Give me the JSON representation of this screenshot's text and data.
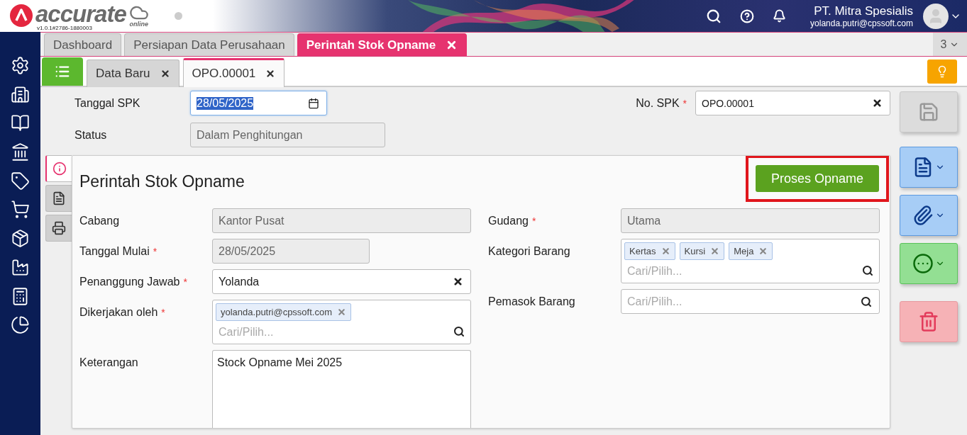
{
  "header": {
    "logo_text": "accurate",
    "logo_sub": "online",
    "version": "v1.0.1#2786-1880003",
    "company": "PT. Mitra Spesialis",
    "email": "yolanda.putri@cpssoft.com"
  },
  "tabs": [
    {
      "label": "Dashboard",
      "selected": false,
      "closable": false
    },
    {
      "label": "Persiapan Data Perusahaan",
      "selected": false,
      "closable": false
    },
    {
      "label": "Perintah Stok Opname",
      "selected": true,
      "closable": true
    }
  ],
  "tab_overflow": "3",
  "subtabs": [
    {
      "label": "Data Baru",
      "selected": false
    },
    {
      "label": "OPO.00001",
      "selected": true
    }
  ],
  "top_fields": {
    "date": {
      "label": "Tanggal SPK",
      "value": "28/05/2025",
      "text_selected": true
    },
    "number": {
      "label": "No. SPK",
      "required_mark": "*",
      "value": "OPO.00001"
    },
    "status": {
      "label": "Status",
      "value": "Dalam Penghitungan",
      "disabled": true
    }
  },
  "side_tabs": [
    {
      "kind": "info",
      "selected": true
    },
    {
      "kind": "document",
      "selected": false
    },
    {
      "kind": "print",
      "selected": false
    }
  ],
  "card": {
    "title": "Perintah Stok Opname",
    "action": {
      "label": "Proses Opname",
      "highlighted": true
    },
    "left_fields": [
      {
        "kind": "text",
        "label": "Cabang",
        "disabled": true,
        "value": "Kantor Pusat"
      },
      {
        "kind": "date",
        "label": "Tanggal Mulai",
        "required_mark": "*",
        "disabled": true,
        "value": "28/05/2025"
      },
      {
        "kind": "text",
        "label": "Penanggung Jawab",
        "required_mark": "*",
        "disabled": false,
        "clearable": true,
        "value": "Yolanda"
      },
      {
        "kind": "tags",
        "label": "Dikerjakan oleh",
        "required_mark": "*",
        "tags": [
          "yolanda.putri@cpssoft.com"
        ],
        "placeholder": "Cari/Pilih..."
      },
      {
        "kind": "textarea",
        "label": "Keterangan",
        "value": "Stock Opname Mei 2025"
      }
    ],
    "right_fields": [
      {
        "kind": "text",
        "label": "Gudang",
        "required_mark": "*",
        "disabled": true,
        "value": "Utama"
      },
      {
        "kind": "tags",
        "label": "Kategori Barang",
        "tags": [
          "Kertas",
          "Kursi",
          "Meja"
        ],
        "placeholder": "Cari/Pilih..."
      },
      {
        "kind": "lookup",
        "label": "Pemasok Barang",
        "placeholder": "Cari/Pilih..."
      }
    ]
  },
  "actions": [
    {
      "kind": "save",
      "disabled": true
    },
    {
      "kind": "document",
      "disabled": false
    },
    {
      "kind": "attach",
      "disabled": false
    },
    {
      "kind": "more",
      "disabled": false
    },
    {
      "kind": "delete",
      "disabled": false
    }
  ]
}
